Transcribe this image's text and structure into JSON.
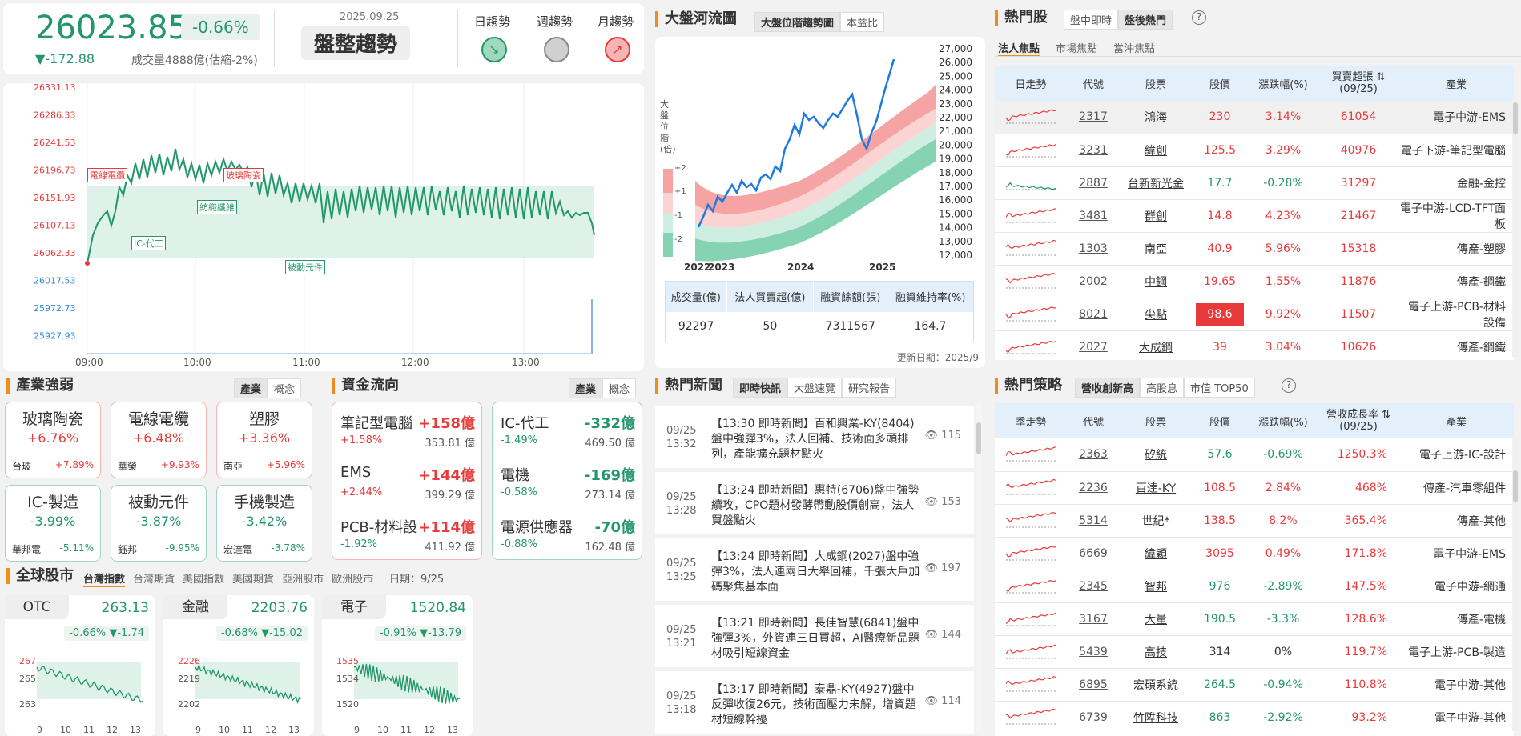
{
  "header": {
    "index": "26023.85",
    "change_pct": "-0.66%",
    "change": "▼-172.88",
    "volume": "成交量4888億(估縮-2%)",
    "date": "2025.09.25",
    "trend": "盤整趨勢",
    "day_label": "日趨勢",
    "week_label": "週趨勢",
    "month_label": "月趨勢",
    "day_icon": "↘",
    "month_icon": "↗"
  },
  "intraday": {
    "yticks": [
      "26331.13",
      "26286.33",
      "26241.53",
      "26196.73",
      "26151.93",
      "26107.13",
      "26062.33",
      "26017.53",
      "25972.73",
      "25927.93"
    ],
    "xticks": [
      "09:00",
      "10:00",
      "11:00",
      "12:00",
      "13:00"
    ],
    "tags": [
      "電線電纜",
      "玻璃陶瓷",
      "紡織纖維",
      "IC-代工",
      "被動元件"
    ]
  },
  "river": {
    "title": "大盤河流圖",
    "tab1": "大盤位階趨勢圖",
    "tab2": "本益比",
    "ylabel": "大盤位階(倍)",
    "bands": [
      "+2",
      "+1",
      "-1",
      "-2"
    ],
    "yticks": [
      "27,000",
      "26,000",
      "25,000",
      "24,000",
      "23,000",
      "22,000",
      "21,000",
      "20,000",
      "19,000",
      "18,000",
      "17,000",
      "16,000",
      "15,000",
      "14,000",
      "13,000",
      "12,000"
    ],
    "xticks": [
      "2022",
      "2023",
      "2024",
      "2025"
    ],
    "table_headers": [
      "成交量(億)",
      "法人買賣超(億)",
      "融資餘額(張)",
      "融資維持率(%)"
    ],
    "table_values": [
      "92297",
      "50",
      "7311567",
      "164.7"
    ],
    "updated": "更新日期：2025/9"
  },
  "industry": {
    "title": "產業強弱",
    "tab1": "產業",
    "tab2": "概念",
    "items": [
      {
        "name": "玻璃陶瓷",
        "pct": "+6.76%",
        "stock": "台玻",
        "spct": "+7.89%",
        "up": true
      },
      {
        "name": "電線電纜",
        "pct": "+6.48%",
        "stock": "華榮",
        "spct": "+9.93%",
        "up": true
      },
      {
        "name": "塑膠",
        "pct": "+3.36%",
        "stock": "南亞",
        "spct": "+5.96%",
        "up": true
      },
      {
        "name": "IC-製造",
        "pct": "-3.99%",
        "stock": "華邦電",
        "spct": "-5.11%",
        "up": false
      },
      {
        "name": "被動元件",
        "pct": "-3.87%",
        "stock": "鈺邦",
        "spct": "-9.95%",
        "up": false
      },
      {
        "name": "手機製造",
        "pct": "-3.42%",
        "stock": "宏達電",
        "spct": "-3.78%",
        "up": false
      }
    ]
  },
  "fund": {
    "title": "資金流向",
    "tab1": "產業",
    "tab2": "概念",
    "inflow": [
      {
        "name": "筆記型電腦",
        "amt": "+158億",
        "pct": "+1.58%",
        "val": "353.81",
        "unit": "億"
      },
      {
        "name": "EMS",
        "amt": "+144億",
        "pct": "+2.44%",
        "val": "399.29",
        "unit": "億"
      },
      {
        "name": "PCB-材料設",
        "amt": "+114億",
        "pct": "-1.92%",
        "val": "411.92",
        "unit": "億"
      }
    ],
    "outflow": [
      {
        "name": "IC-代工",
        "amt": "-332億",
        "pct": "-1.49%",
        "val": "469.50",
        "unit": "億"
      },
      {
        "name": "電機",
        "amt": "-169億",
        "pct": "-0.58%",
        "val": "273.14",
        "unit": "億"
      },
      {
        "name": "電源供應器",
        "amt": "-70億",
        "pct": "-0.88%",
        "val": "162.48",
        "unit": "億"
      }
    ]
  },
  "global": {
    "title": "全球股市",
    "tabs": [
      "台灣指數",
      "台灣期貨",
      "美國指數",
      "美國期貨",
      "亞洲股市",
      "歐洲股市"
    ],
    "date": "日期：9/25",
    "cards": [
      {
        "name": "OTC",
        "value": "263.13",
        "pct": "-0.66%",
        "chg": "▼-1.74",
        "ytop": "267",
        "ymid": "265",
        "ybot": "263"
      },
      {
        "name": "金融",
        "value": "2203.76",
        "pct": "-0.68%",
        "chg": "▼-15.02",
        "ytop": "2226",
        "ymid": "2219",
        "ybot": "2202"
      },
      {
        "name": "電子",
        "value": "1520.84",
        "pct": "-0.91%",
        "chg": "▼-13.79",
        "ytop": "1535",
        "ymid": "1534",
        "ybot": "1520"
      }
    ],
    "xticks": [
      "9",
      "10",
      "11",
      "12",
      "13"
    ]
  },
  "news": {
    "title": "熱門新聞",
    "tabs": [
      "即時快訊",
      "大盤速覽",
      "研究報告"
    ],
    "items": [
      {
        "date": "09/25",
        "time": "13:32",
        "text": "【13:30 即時新聞】百和興業-KY(8404)盤中強彈3%，法人回補、技術面多頭排列，產能擴充題材點火",
        "views": "115"
      },
      {
        "date": "09/25",
        "time": "13:28",
        "text": "【13:24 即時新聞】惠特(6706)盤中強勢續攻，CPO題材發酵帶動股價創高，法人買盤點火",
        "views": "153"
      },
      {
        "date": "09/25",
        "time": "13:25",
        "text": "【13:24 即時新聞】大成鋼(2027)盤中強彈3%，法人連兩日大舉回補，千張大戶加碼聚焦基本面",
        "views": "197"
      },
      {
        "date": "09/25",
        "time": "13:21",
        "text": "【13:21 即時新聞】長佳智慧(6841)盤中強彈3%，外資連三日買超，AI醫療新品題材吸引短線資金",
        "views": "144"
      },
      {
        "date": "09/25",
        "time": "13:18",
        "text": "【13:17 即時新聞】泰鼎-KY(4927)盤中反彈收復26元，技術面壓力未解，增資題材短線幹擾",
        "views": "114"
      }
    ]
  },
  "hot": {
    "title": "熱門股",
    "tabs": [
      "盤中即時",
      "盤後熱門"
    ],
    "subtabs": [
      "法人焦點",
      "市場焦點",
      "當沖焦點"
    ],
    "headers": [
      "日走勢",
      "代號",
      "股票",
      "股價",
      "漲跌幅(%)",
      "買賣超張",
      "(09/25)",
      "產業"
    ],
    "rows": [
      {
        "code": "2317",
        "name": "鴻海",
        "price": "230",
        "pct": "3.14%",
        "vol": "61054",
        "ind": "電子中游-EMS",
        "up": true
      },
      {
        "code": "3231",
        "name": "緯創",
        "price": "125.5",
        "pct": "3.29%",
        "vol": "40976",
        "ind": "電子下游-筆記型電腦",
        "up": true
      },
      {
        "code": "2887",
        "name": "台新新光金",
        "price": "17.7",
        "pct": "-0.28%",
        "vol": "31297",
        "ind": "金融-金控",
        "up": false
      },
      {
        "code": "3481",
        "name": "群創",
        "price": "14.8",
        "pct": "4.23%",
        "vol": "21467",
        "ind": "電子中游-LCD-TFT面板",
        "up": true
      },
      {
        "code": "1303",
        "name": "南亞",
        "price": "40.9",
        "pct": "5.96%",
        "vol": "15318",
        "ind": "傳產-塑膠",
        "up": true
      },
      {
        "code": "2002",
        "name": "中鋼",
        "price": "19.65",
        "pct": "1.55%",
        "vol": "11876",
        "ind": "傳產-鋼鐵",
        "up": true
      },
      {
        "code": "8021",
        "name": "尖點",
        "price": "98.6",
        "pct": "9.92%",
        "vol": "11507",
        "ind": "電子上游-PCB-材料設備",
        "up": true,
        "limit": true
      },
      {
        "code": "2027",
        "name": "大成鋼",
        "price": "39",
        "pct": "3.04%",
        "vol": "10626",
        "ind": "傳產-鋼鐵",
        "up": true
      }
    ]
  },
  "strategy": {
    "title": "熱門策略",
    "tabs": [
      "營收創新高",
      "高股息",
      "市值 TOP50"
    ],
    "headers": [
      "季走勢",
      "代號",
      "股票",
      "股價",
      "漲跌幅(%)",
      "營收成長率",
      "(09/25)",
      "產業"
    ],
    "rows": [
      {
        "code": "2363",
        "name": "矽統",
        "price": "57.6",
        "pct": "-0.69%",
        "g": "1250.3%",
        "ind": "電子上游-IC-設計",
        "up": false
      },
      {
        "code": "2236",
        "name": "百達-KY",
        "price": "108.5",
        "pct": "2.84%",
        "g": "468%",
        "ind": "傳產-汽車零組件",
        "up": true
      },
      {
        "code": "5314",
        "name": "世紀*",
        "price": "138.5",
        "pct": "8.2%",
        "g": "365.4%",
        "ind": "傳產-其他",
        "up": true
      },
      {
        "code": "6669",
        "name": "緯穎",
        "price": "3095",
        "pct": "0.49%",
        "g": "171.8%",
        "ind": "電子中游-EMS",
        "up": true
      },
      {
        "code": "2345",
        "name": "智邦",
        "price": "976",
        "pct": "-2.89%",
        "g": "147.5%",
        "ind": "電子中游-網通",
        "up": false
      },
      {
        "code": "3167",
        "name": "大量",
        "price": "190.5",
        "pct": "-3.3%",
        "g": "128.6%",
        "ind": "傳產-電機",
        "up": false
      },
      {
        "code": "5439",
        "name": "高技",
        "price": "314",
        "pct": "0%",
        "g": "119.7%",
        "ind": "電子上游-PCB-製造",
        "up": null
      },
      {
        "code": "6895",
        "name": "宏碩系統",
        "price": "264.5",
        "pct": "-0.94%",
        "g": "110.8%",
        "ind": "電子中游-其他",
        "up": false
      },
      {
        "code": "6739",
        "name": "竹陞科技",
        "price": "863",
        "pct": "-2.92%",
        "g": "93.2%",
        "ind": "電子中游-其他",
        "up": false
      }
    ]
  }
}
